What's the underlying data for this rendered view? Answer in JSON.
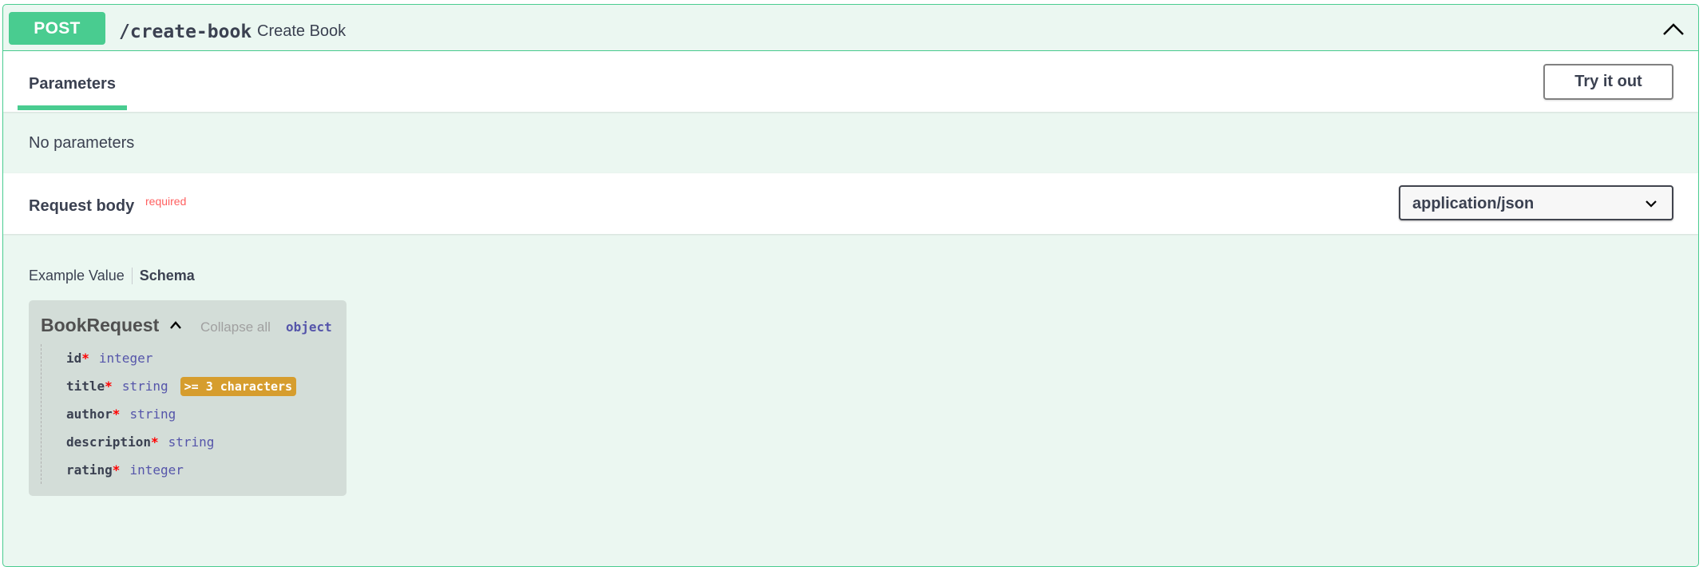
{
  "endpoint": {
    "method": "POST",
    "path": "/create-book",
    "description": "Create Book"
  },
  "parameters": {
    "tab_label": "Parameters",
    "try_it_out_label": "Try it out",
    "empty_text": "No parameters"
  },
  "request_body": {
    "title": "Request body",
    "required_label": "required",
    "content_type": "application/json"
  },
  "example_tabs": {
    "example_label": "Example Value",
    "schema_label": "Schema"
  },
  "model": {
    "name": "BookRequest",
    "collapse_all": "Collapse all",
    "type": "object",
    "properties": [
      {
        "name": "id",
        "required": "*",
        "type": "integer",
        "constraint": ""
      },
      {
        "name": "title",
        "required": "*",
        "type": "string",
        "constraint": ">= 3 characters"
      },
      {
        "name": "author",
        "required": "*",
        "type": "string",
        "constraint": ""
      },
      {
        "name": "description",
        "required": "*",
        "type": "string",
        "constraint": ""
      },
      {
        "name": "rating",
        "required": "*",
        "type": "integer",
        "constraint": ""
      }
    ]
  },
  "colors": {
    "post_green": "#49cc90",
    "post_bg": "#ebf7f1",
    "required_red": "#ff6060",
    "type_blue": "#55aa",
    "constraint_orange": "#d69d2e"
  },
  "icons": {
    "collapse_operation": "chevron-up-icon",
    "content_type_dropdown": "chevron-down-icon",
    "model_toggle": "chevron-up-icon"
  }
}
